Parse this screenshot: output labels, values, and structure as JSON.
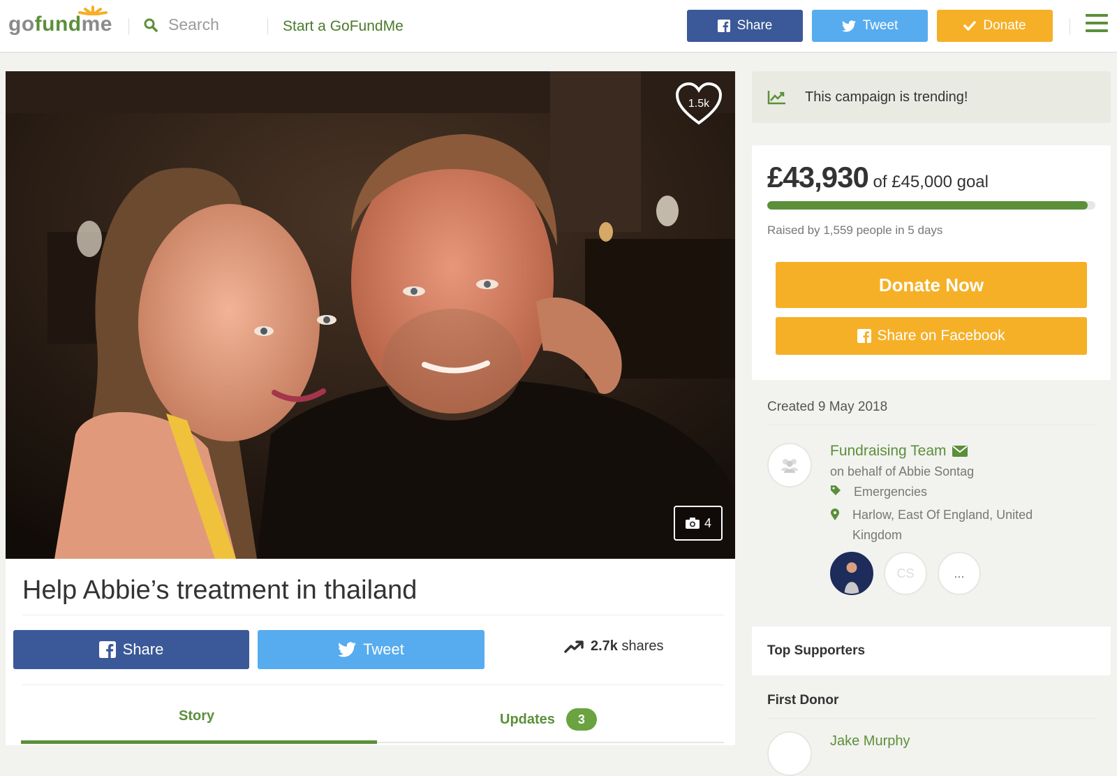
{
  "header": {
    "logo": {
      "part1": "go",
      "part2": "fund",
      "part3": "me"
    },
    "search_placeholder": "Search",
    "start_link": "Start a GoFundMe",
    "share_label": "Share",
    "tweet_label": "Tweet",
    "donate_label": "Donate"
  },
  "campaign": {
    "hearts": "1.5k",
    "photo_count": "4",
    "title": "Help Abbie’s treatment in thailand",
    "share_label": "Share",
    "tweet_label": "Tweet",
    "shares_count": "2.7k",
    "shares_label": "shares",
    "tabs": [
      {
        "label": "Story"
      },
      {
        "label": "Updates",
        "badge": "3"
      }
    ]
  },
  "sidebar": {
    "trending": "This campaign is trending!",
    "raised_amount": "£43,930",
    "goal_text": "of £45,000 goal",
    "progress_fraction": 0.976,
    "raised_by": "Raised by 1,559 people in 5 days",
    "donate_now": "Donate Now",
    "share_facebook": "Share on Facebook",
    "created": "Created 9 May 2018",
    "organizer": {
      "name": "Fundraising Team",
      "on_behalf": "on behalf of Abbie Sontag",
      "category": "Emergencies",
      "location": "Harlow, East Of England, United Kingdom",
      "team_initials": "CS",
      "more": "..."
    },
    "top_supporters": "Top Supporters",
    "first_donor_label": "First Donor",
    "first_donor_name": "Jake Murphy"
  },
  "colors": {
    "brand_green": "#5b8f3a",
    "facebook": "#3b5998",
    "twitter": "#56acee",
    "donate": "#f5b027"
  }
}
